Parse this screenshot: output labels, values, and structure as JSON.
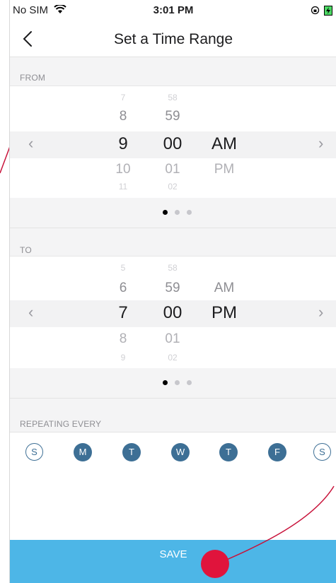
{
  "status": {
    "carrier": "No SIM",
    "time": "3:01 PM"
  },
  "header": {
    "title": "Set a Time Range"
  },
  "from": {
    "label": "FROM",
    "hours": [
      "7",
      "8",
      "9",
      "10",
      "11"
    ],
    "minutes": [
      "58",
      "59",
      "00",
      "01",
      "02"
    ],
    "period_selected": "AM",
    "period_other": "PM"
  },
  "to": {
    "label": "TO",
    "hours": [
      "5",
      "6",
      "7",
      "8",
      "9"
    ],
    "minutes": [
      "58",
      "59",
      "00",
      "01",
      "02"
    ],
    "period_other": "AM",
    "period_selected": "PM"
  },
  "repeat": {
    "label": "REPEATING EVERY",
    "days": [
      "S",
      "M",
      "T",
      "W",
      "T",
      "F",
      "S"
    ],
    "selected": [
      false,
      true,
      true,
      true,
      true,
      true,
      false
    ]
  },
  "pager": {
    "active_index": 0,
    "count": 3
  },
  "save_label": "SAVE",
  "colors": {
    "accent": "#3d6f95",
    "save_bar": "#4db6e7",
    "marker": "#e0143c"
  }
}
